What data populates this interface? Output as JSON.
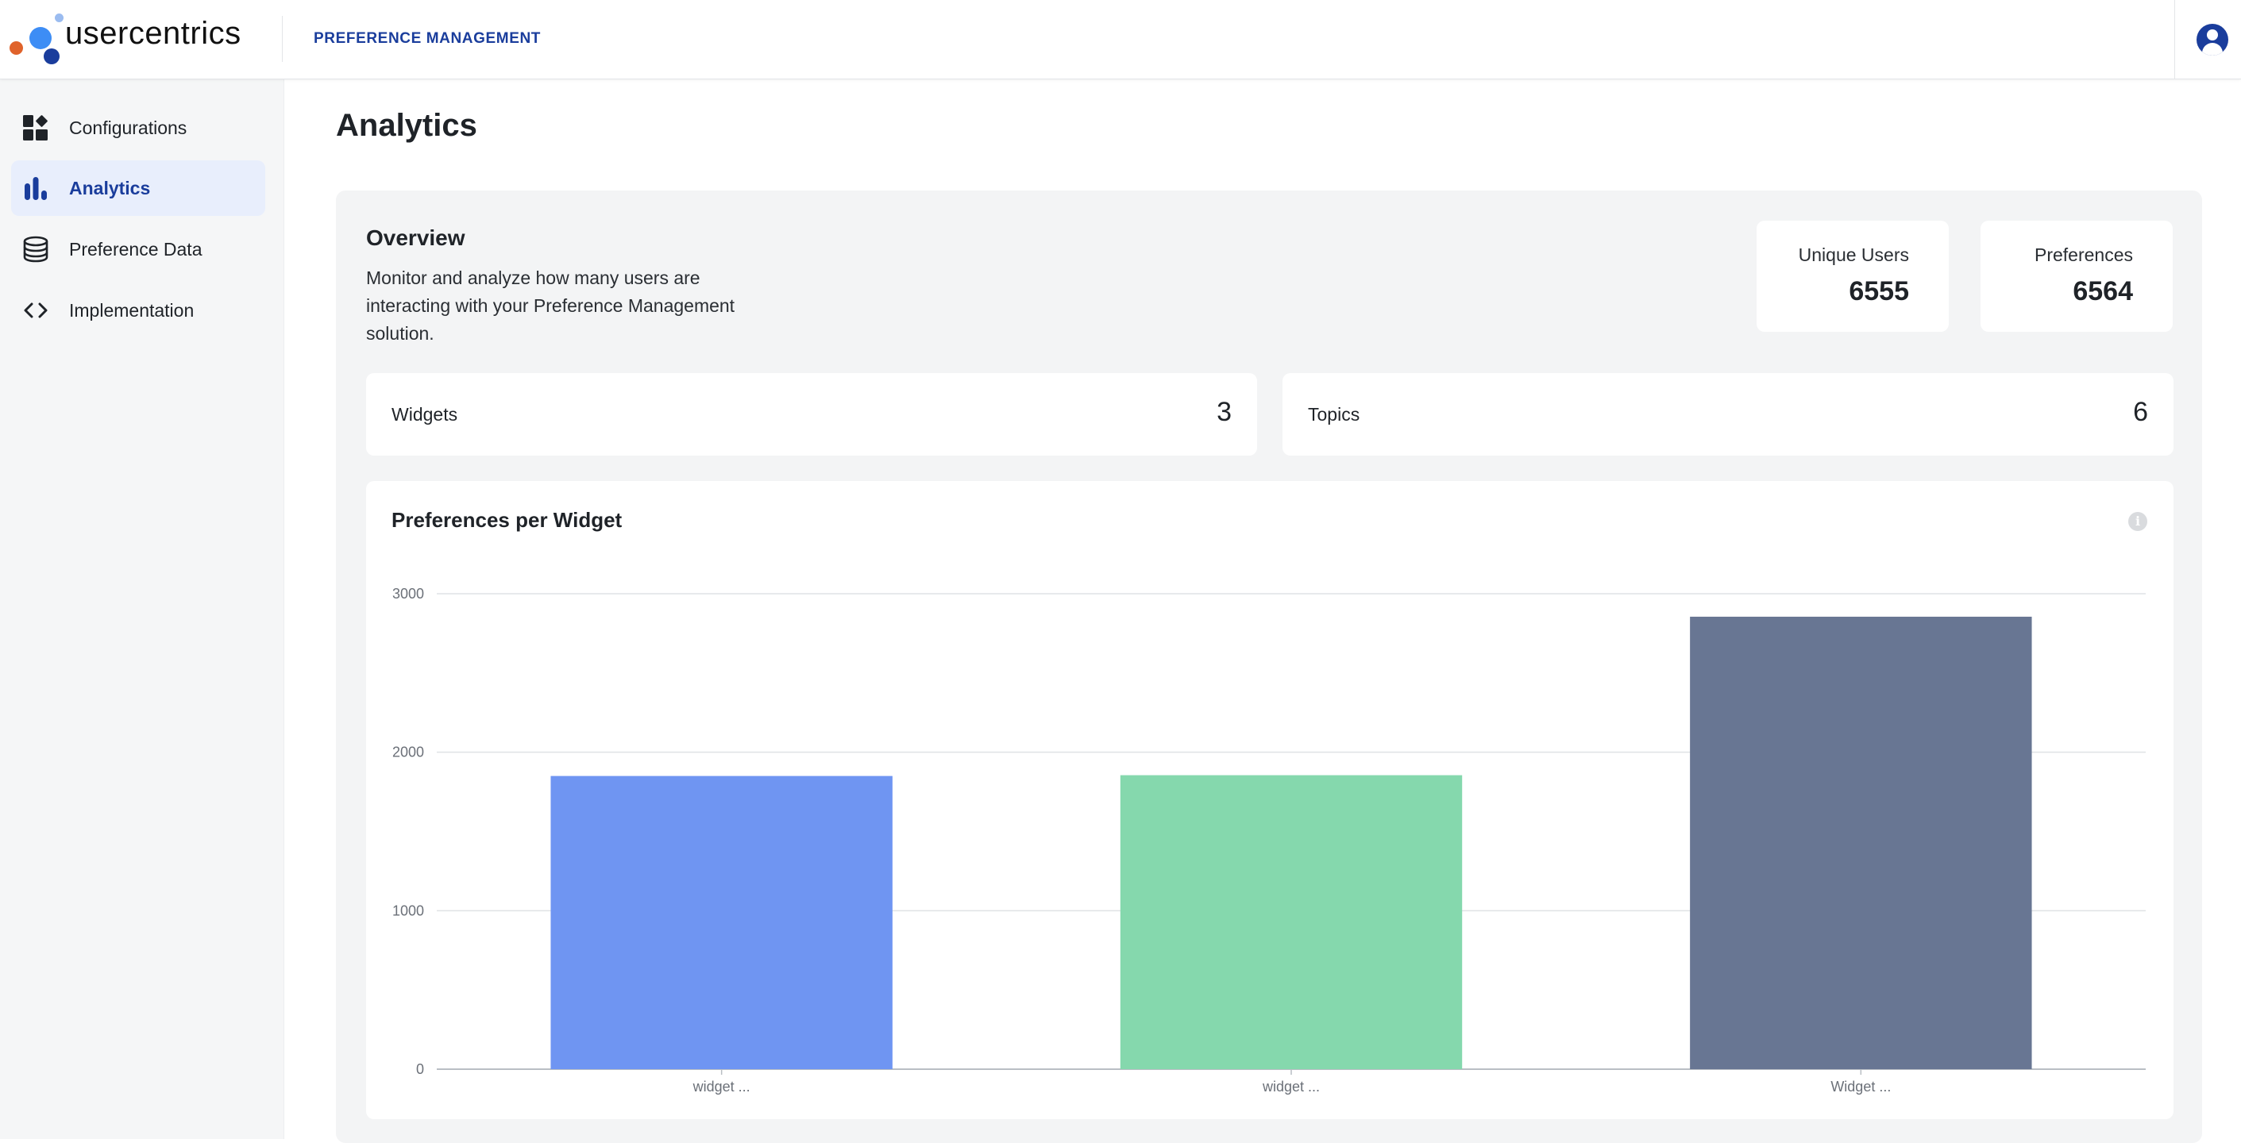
{
  "header": {
    "logo_text_bold": "user",
    "logo_text_regular": "centrics",
    "product_name": "PREFERENCE MANAGEMENT",
    "avatar_icon": "user-avatar-icon"
  },
  "sidebar": {
    "items": [
      {
        "label": "Configurations",
        "icon": "dashboard-grid-icon",
        "active": false
      },
      {
        "label": "Analytics",
        "icon": "bar-chart-icon",
        "active": true
      },
      {
        "label": "Preference Data",
        "icon": "database-icon",
        "active": false
      },
      {
        "label": "Implementation",
        "icon": "code-brackets-icon",
        "active": false
      }
    ]
  },
  "main": {
    "title": "Analytics",
    "overview": {
      "title": "Overview",
      "description": "Monitor and analyze how many users are interacting with your Preference Management solution.",
      "unique_users": {
        "label": "Unique Users",
        "value": "6555"
      },
      "preferences": {
        "label": "Preferences",
        "value": "6564"
      },
      "widgets": {
        "label": "Widgets",
        "value": "3"
      },
      "topics": {
        "label": "Topics",
        "value": "6"
      }
    },
    "chart_panel": {
      "title": "Preferences per Widget",
      "info_icon": "info-icon"
    }
  },
  "colors": {
    "brand_dark_blue": "#1a3d9c",
    "active_nav_bg": "#e8eefc",
    "bar_1": "#6f95f2",
    "bar_2": "#85d8ad",
    "bar_3": "#687693"
  },
  "chart_data": {
    "type": "bar",
    "categories": [
      "widget ...",
      "widget ...",
      "Widget ..."
    ],
    "values": [
      1850,
      1855,
      2855
    ],
    "colors": [
      "#6f95f2",
      "#85d8ad",
      "#687693"
    ],
    "title": "Preferences per Widget",
    "xlabel": "",
    "ylabel": "",
    "ylim": [
      0,
      3000
    ],
    "yticks": [
      0,
      1000,
      2000,
      3000
    ],
    "grid": true,
    "legend": "none"
  }
}
